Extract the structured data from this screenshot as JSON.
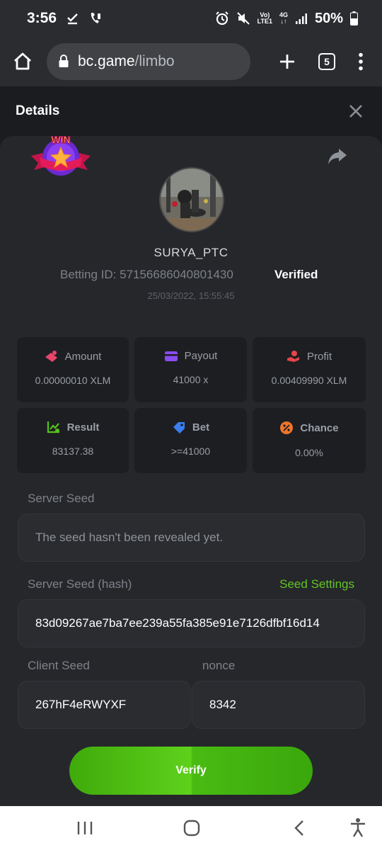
{
  "status_bar": {
    "time": "3:56",
    "network_top": "Vo)",
    "network_bottom": "LTE1",
    "data_top": "4G",
    "data_bottom": "↓↑",
    "battery": "50%"
  },
  "browser": {
    "url_host": "bc.game",
    "url_path": "/limbo",
    "tab_count": "5"
  },
  "details": {
    "title": "Details",
    "badge_text": "WIN",
    "username": "SURYA_PTC",
    "betting_id_label": "Betting ID:",
    "betting_id": "57156686040801430",
    "verified": "Verified",
    "date": "25/03/2022, 15:55:45"
  },
  "stats": {
    "amount": {
      "label": "Amount",
      "value": "0.00000010 XLM",
      "color": "#e8456a"
    },
    "payout": {
      "label": "Payout",
      "value": "41000 x",
      "color": "#8a4bf0"
    },
    "profit": {
      "label": "Profit",
      "value": "0.00409990 XLM",
      "color": "#e8454b"
    },
    "result": {
      "label": "Result",
      "value": "83137.38",
      "color": "#56c21c"
    },
    "bet": {
      "label": "Bet",
      "value": ">=41000",
      "color": "#3c7ef0"
    },
    "chance": {
      "label": "Chance",
      "value": "0.00%",
      "color": "#f0752b"
    }
  },
  "fields": {
    "server_seed_label": "Server Seed",
    "server_seed_value": "The seed hasn't been revealed yet.",
    "server_seed_hash_label": "Server Seed (hash)",
    "seed_settings": "Seed Settings",
    "server_seed_hash_value": "83d09267ae7ba7ee239a55fa385e91e7126dfbf16d14",
    "client_seed_label": "Client Seed",
    "client_seed_value": "267hF4eRWYXF",
    "nonce_label": "nonce",
    "nonce_value": "8342"
  },
  "verify_button": "Verify",
  "colors": {
    "accent_green": "#62c425",
    "background": "#1b1c20",
    "card": "#25272b"
  }
}
